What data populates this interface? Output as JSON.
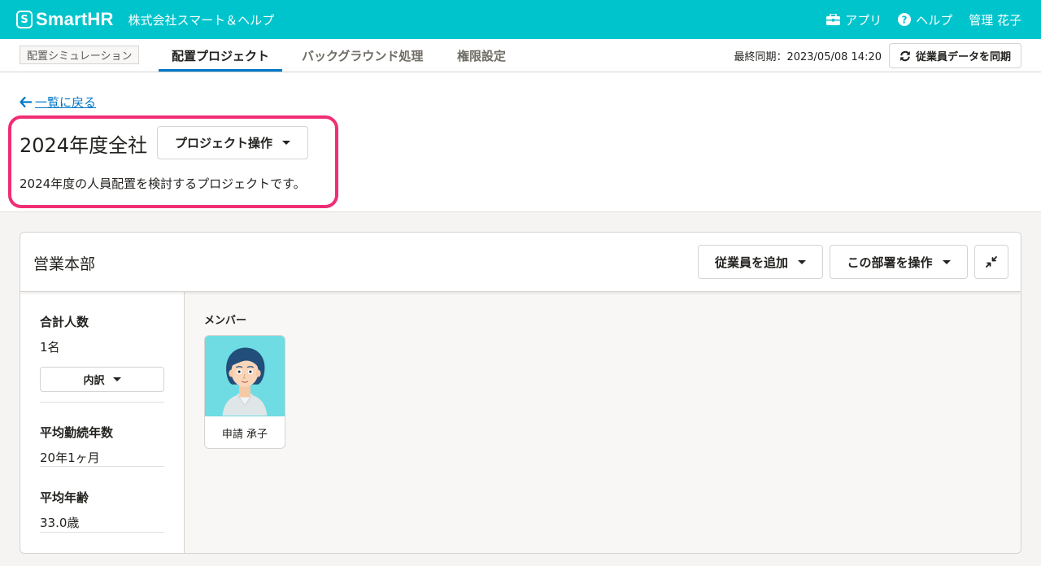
{
  "header": {
    "logo_mark": "S",
    "logo_text": "SmartHR",
    "company": "株式会社スマート＆ヘルプ",
    "apps_label": "アプリ",
    "help_label": "ヘルプ",
    "user_name": "管理 花子"
  },
  "nav": {
    "chip": "配置シミュレーション",
    "tabs": [
      {
        "label": "配置プロジェクト",
        "active": true
      },
      {
        "label": "バックグラウンド処理",
        "active": false
      },
      {
        "label": "権限設定",
        "active": false
      }
    ],
    "last_sync": "最終同期：2023/05/08 14:20",
    "sync_button": "従業員データを同期"
  },
  "project": {
    "back_link": "一覧に戻る",
    "title": "2024年度全社",
    "operation_button": "プロジェクト操作",
    "description": "2024年度の人員配置を検討するプロジェクトです。"
  },
  "department": {
    "name": "営業本部",
    "add_employee_button": "従業員を追加",
    "operate_button": "この部署を操作",
    "stats": [
      {
        "label": "合計人数",
        "value": "1名"
      },
      {
        "label": "平均勤続年数",
        "value": "20年1ヶ月"
      },
      {
        "label": "平均年齢",
        "value": "33.0歳"
      }
    ],
    "breakdown_button": "内訳",
    "members_label": "メンバー",
    "members": [
      {
        "name": "申請 承子"
      }
    ]
  },
  "colors": {
    "brand": "#00c4cc",
    "link": "#0077c7",
    "highlight": "#f02d75",
    "avatar_bg": "#6fdce3"
  }
}
